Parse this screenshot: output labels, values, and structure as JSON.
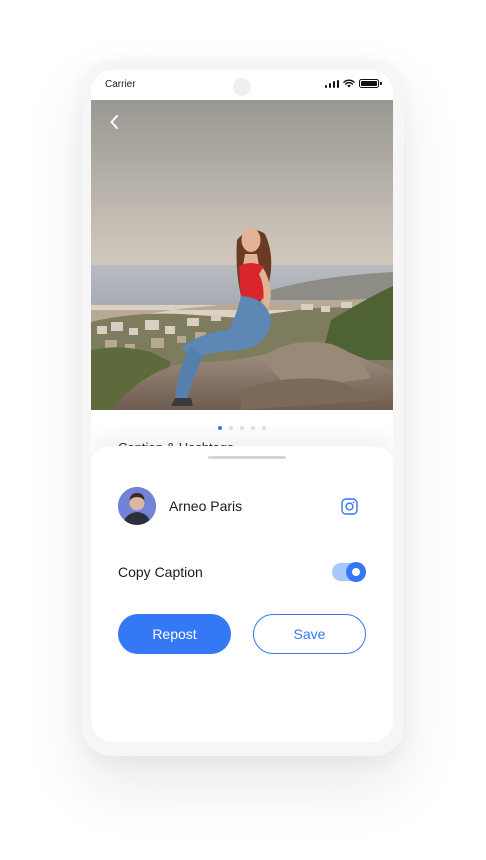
{
  "status_bar": {
    "carrier": "Carrier",
    "battery_level": 1.0
  },
  "photo": {
    "icon": "back-chevron-icon",
    "pages": 5,
    "active_page": 0
  },
  "caption_peek": "Caption & Hashtags",
  "profile": {
    "username": "Arneo Paris",
    "action_icon": "instagram-icon"
  },
  "copy_caption": {
    "label": "Copy Caption",
    "enabled": true
  },
  "actions": {
    "primary_label": "Repost",
    "secondary_label": "Save"
  },
  "colors": {
    "accent": "#3478f6",
    "toggle_track": "#a9c8fb",
    "text": "#1b1b1f"
  }
}
